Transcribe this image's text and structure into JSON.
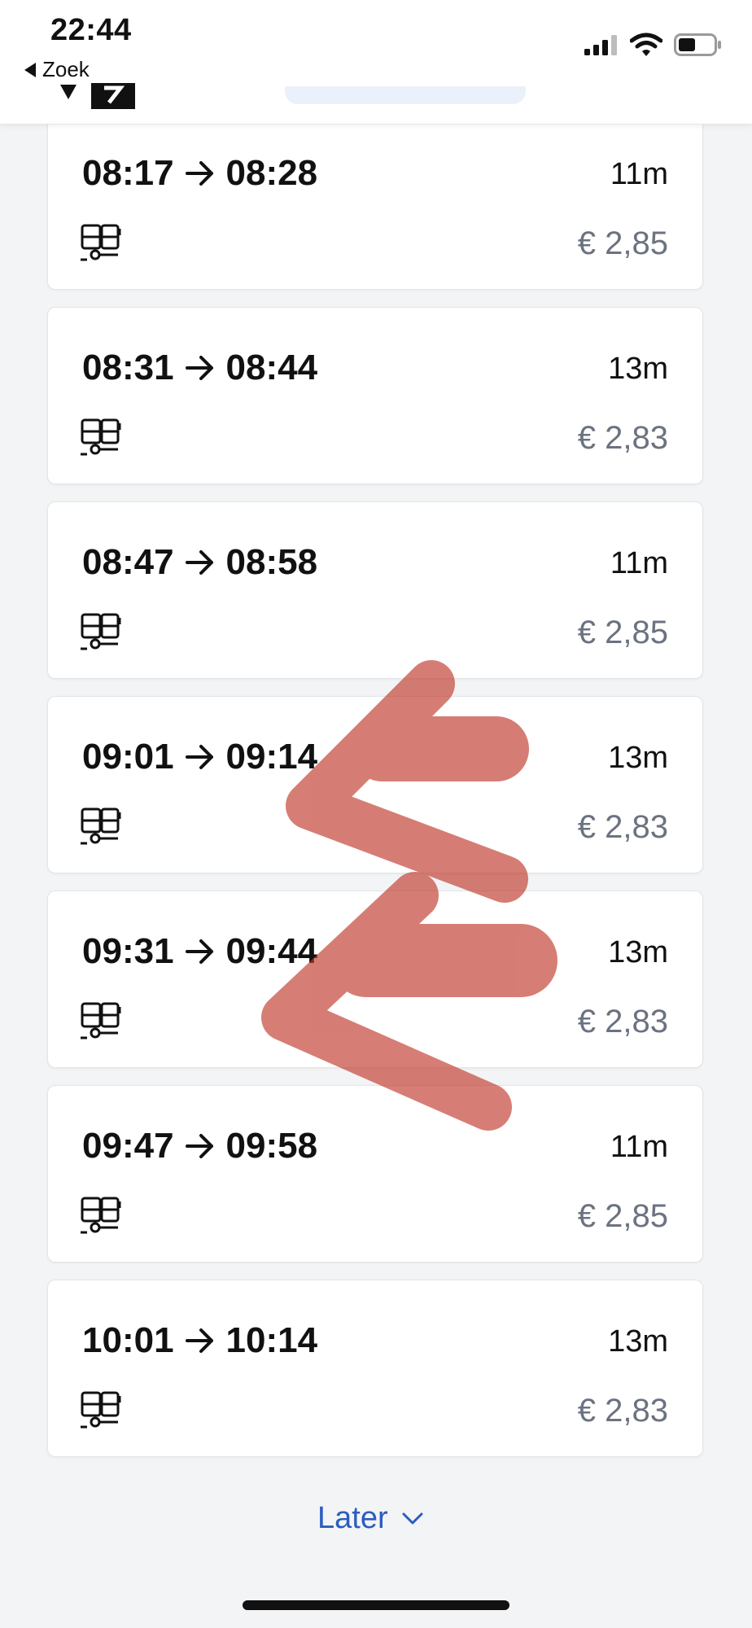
{
  "status_bar": {
    "time": "22:44",
    "back_label": "Zoek"
  },
  "trips": [
    {
      "depart": "08:17",
      "arrive": "08:28",
      "duration": "11m",
      "price": "€ 2,85"
    },
    {
      "depart": "08:31",
      "arrive": "08:44",
      "duration": "13m",
      "price": "€ 2,83"
    },
    {
      "depart": "08:47",
      "arrive": "08:58",
      "duration": "11m",
      "price": "€ 2,85"
    },
    {
      "depart": "09:01",
      "arrive": "09:14",
      "duration": "13m",
      "price": "€ 2,83"
    },
    {
      "depart": "09:31",
      "arrive": "09:44",
      "duration": "13m",
      "price": "€ 2,83"
    },
    {
      "depart": "09:47",
      "arrive": "09:58",
      "duration": "11m",
      "price": "€ 2,85"
    },
    {
      "depart": "10:01",
      "arrive": "10:14",
      "duration": "13m",
      "price": "€ 2,83"
    }
  ],
  "later_label": "Later",
  "icons": {
    "vehicle": "tram-icon",
    "arrow": "arrow-right-icon",
    "later": "chevron-down-icon"
  },
  "colors": {
    "link": "#2b5dbf",
    "price": "#6b7280",
    "annotation": "#c0392b"
  }
}
